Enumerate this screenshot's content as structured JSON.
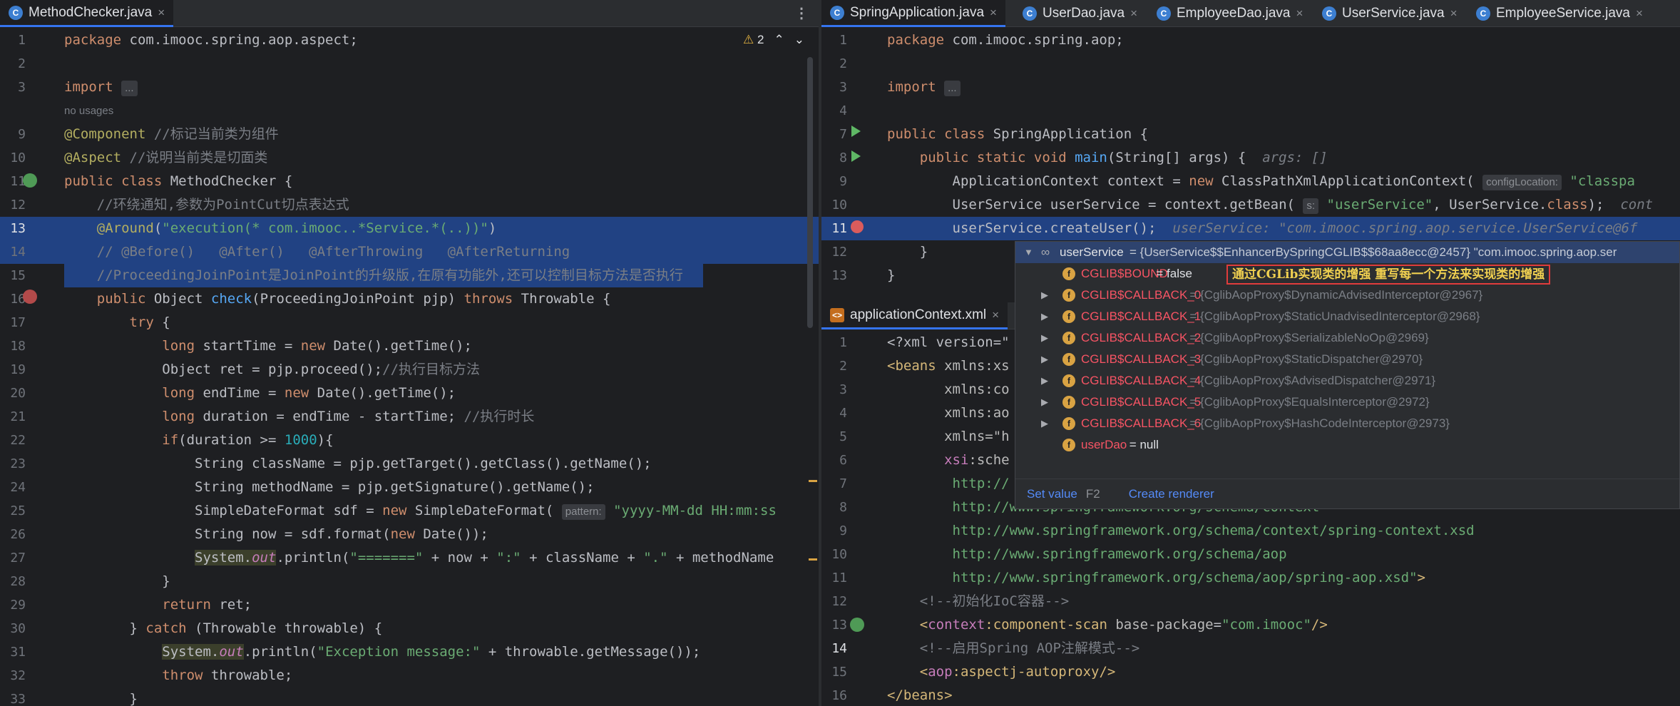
{
  "left_tabs": [
    {
      "label": "MethodChecker.java",
      "close": "×"
    }
  ],
  "right_top_tabs": [
    {
      "label": "SpringApplication.java",
      "close": "×"
    },
    {
      "label": "UserDao.java",
      "close": "×"
    },
    {
      "label": "EmployeeDao.java",
      "close": "×"
    },
    {
      "label": "UserService.java",
      "close": "×"
    },
    {
      "label": "EmployeeService.java",
      "close": "×"
    }
  ],
  "right_bottom_tab": {
    "label": "applicationContext.xml",
    "close": "×"
  },
  "kebab": "⋮",
  "warnings": {
    "count": "2",
    "up": "⌃",
    "down": "⌄",
    "triangle": "⚠"
  },
  "left_lines": [
    {
      "n": "1",
      "parts": [
        [
          "kw",
          "package "
        ],
        [
          "",
          "com.imooc.spring.aop.aspect;"
        ]
      ]
    },
    {
      "n": "2",
      "parts": []
    },
    {
      "n": "3",
      "parts": [
        [
          "kw",
          "import "
        ],
        [
          "hint",
          "..."
        ]
      ]
    },
    {
      "n": "",
      "parts": [
        [
          "usage",
          "no usages"
        ]
      ]
    },
    {
      "n": "9",
      "parts": [
        [
          "ann",
          "@Component "
        ],
        [
          "cmt",
          "//标记当前类为组件"
        ]
      ]
    },
    {
      "n": "10",
      "parts": [
        [
          "ann",
          "@Aspect "
        ],
        [
          "cmt",
          "//说明当前类是切面类"
        ]
      ]
    },
    {
      "n": "11",
      "parts": [
        [
          "kw",
          "public class "
        ],
        [
          "",
          "MethodChecker {"
        ]
      ]
    },
    {
      "n": "12",
      "parts": [
        [
          "",
          "    "
        ],
        [
          "cmt",
          "//环绕通知,参数为PointCut切点表达式"
        ]
      ]
    },
    {
      "n": "13",
      "parts": [
        [
          "",
          "    "
        ],
        [
          "ann",
          "@Around"
        ],
        [
          "",
          "("
        ],
        [
          "str",
          "\"execution(* com.imooc..*Service.*(..))\""
        ],
        [
          "",
          ")"
        ]
      ]
    },
    {
      "n": "14",
      "parts": [
        [
          "",
          "    "
        ],
        [
          "cmt",
          "// @Before()   @After()   @AfterThrowing   @AfterReturning"
        ]
      ]
    },
    {
      "n": "15",
      "parts": [
        [
          "",
          "    "
        ],
        [
          "cmt",
          "//ProceedingJoinPoint是JoinPoint的升级版,在原有功能外,还可以控制目标方法是否执行"
        ]
      ]
    },
    {
      "n": "16",
      "parts": [
        [
          "",
          "    "
        ],
        [
          "kw",
          "public "
        ],
        [
          "",
          "Object "
        ],
        [
          "fn",
          "check"
        ],
        [
          "",
          "(ProceedingJoinPoint pjp) "
        ],
        [
          "kw",
          "throws "
        ],
        [
          "",
          "Throwable {"
        ]
      ]
    },
    {
      "n": "17",
      "parts": [
        [
          "",
          "        "
        ],
        [
          "kw",
          "try "
        ],
        [
          "",
          "{"
        ]
      ]
    },
    {
      "n": "18",
      "parts": [
        [
          "",
          "            "
        ],
        [
          "kw",
          "long "
        ],
        [
          "",
          "startTime = "
        ],
        [
          "kw",
          "new "
        ],
        [
          "",
          "Date().getTime();"
        ]
      ]
    },
    {
      "n": "19",
      "parts": [
        [
          "",
          "            Object ret = pjp.proceed();"
        ],
        [
          "cmt",
          "//执行目标方法"
        ]
      ]
    },
    {
      "n": "20",
      "parts": [
        [
          "",
          "            "
        ],
        [
          "kw",
          "long "
        ],
        [
          "",
          "endTime = "
        ],
        [
          "kw",
          "new "
        ],
        [
          "",
          "Date().getTime();"
        ]
      ]
    },
    {
      "n": "21",
      "parts": [
        [
          "",
          "            "
        ],
        [
          "kw",
          "long "
        ],
        [
          "",
          "duration = endTime - startTime; "
        ],
        [
          "cmt",
          "//执行时长"
        ]
      ]
    },
    {
      "n": "22",
      "parts": [
        [
          "",
          "            "
        ],
        [
          "kw",
          "if"
        ],
        [
          "",
          "(duration >= "
        ],
        [
          "num",
          "1000"
        ],
        [
          "",
          "){"
        ]
      ]
    },
    {
      "n": "23",
      "parts": [
        [
          "",
          "                String className = pjp.getTarget().getClass().getName();"
        ]
      ]
    },
    {
      "n": "24",
      "parts": [
        [
          "",
          "                String methodName = pjp.getSignature().getName();"
        ]
      ]
    },
    {
      "n": "25",
      "parts": [
        [
          "",
          "                SimpleDateFormat sdf = "
        ],
        [
          "kw",
          "new "
        ],
        [
          "",
          "SimpleDateFormat( "
        ],
        [
          "hint",
          "pattern:"
        ],
        [
          "str",
          " \"yyyy-MM-dd HH:mm:ss"
        ]
      ]
    },
    {
      "n": "26",
      "parts": [
        [
          "",
          "                String now = sdf.format("
        ],
        [
          "kw",
          "new "
        ],
        [
          "",
          "Date());"
        ]
      ]
    },
    {
      "n": "27",
      "parts": [
        [
          "",
          "                "
        ],
        [
          "sys",
          "System."
        ],
        [
          "sysf",
          "out"
        ],
        [
          "",
          ".println("
        ],
        [
          "str",
          "\"=======\""
        ],
        [
          "",
          " + now + "
        ],
        [
          "str",
          "\":\""
        ],
        [
          "",
          " + className + "
        ],
        [
          "str",
          "\".\""
        ],
        [
          "",
          " + methodName"
        ]
      ]
    },
    {
      "n": "28",
      "parts": [
        [
          "",
          "            }"
        ]
      ]
    },
    {
      "n": "29",
      "parts": [
        [
          "",
          "            "
        ],
        [
          "kw",
          "return "
        ],
        [
          "",
          "ret;"
        ]
      ]
    },
    {
      "n": "30",
      "parts": [
        [
          "",
          "        } "
        ],
        [
          "kw",
          "catch "
        ],
        [
          "",
          "(Throwable throwable) {"
        ]
      ]
    },
    {
      "n": "31",
      "parts": [
        [
          "",
          "            "
        ],
        [
          "sys",
          "System."
        ],
        [
          "sysf",
          "out"
        ],
        [
          "",
          ".println("
        ],
        [
          "str",
          "\"Exception message:\""
        ],
        [
          "",
          " + throwable.getMessage());"
        ]
      ]
    },
    {
      "n": "32",
      "parts": [
        [
          "",
          "            "
        ],
        [
          "kw",
          "throw "
        ],
        [
          "",
          "throwable;"
        ]
      ]
    },
    {
      "n": "33",
      "parts": [
        [
          "",
          "        }"
        ]
      ]
    }
  ],
  "right_top_lines": [
    {
      "n": "1",
      "parts": [
        [
          "kw",
          "package "
        ],
        [
          "",
          "com.imooc.spring.aop;"
        ]
      ]
    },
    {
      "n": "2",
      "parts": []
    },
    {
      "n": "3",
      "parts": [
        [
          "kw",
          "import "
        ],
        [
          "hint",
          "..."
        ]
      ]
    },
    {
      "n": "4",
      "parts": []
    },
    {
      "n": "7",
      "parts": [
        [
          "kw",
          "public class "
        ],
        [
          "",
          "SpringApplication {"
        ]
      ]
    },
    {
      "n": "8",
      "parts": [
        [
          "",
          "    "
        ],
        [
          "kw",
          "public static void "
        ],
        [
          "fn",
          "main"
        ],
        [
          "",
          "(String[] args) {  "
        ],
        [
          "inl",
          "args: []"
        ]
      ]
    },
    {
      "n": "9",
      "parts": [
        [
          "",
          "        ApplicationContext context = "
        ],
        [
          "kw",
          "new "
        ],
        [
          "",
          "ClassPathXmlApplicationContext( "
        ],
        [
          "hint",
          "configLocation:"
        ],
        [
          "str",
          " \"classpa"
        ]
      ]
    },
    {
      "n": "10",
      "parts": [
        [
          "",
          "        UserService userService = context.getBean( "
        ],
        [
          "hint",
          "s:"
        ],
        [
          "str",
          " \"userService\""
        ],
        [
          "",
          ", UserService."
        ],
        [
          "kw",
          "class"
        ],
        [
          "",
          ");  "
        ],
        [
          "inl",
          "cont"
        ]
      ]
    },
    {
      "n": "11",
      "parts": [
        [
          "",
          "        userService.createUser();  "
        ],
        [
          "inl",
          "userService: \"com.imooc.spring.aop.service.UserService@6f"
        ]
      ]
    },
    {
      "n": "12",
      "parts": [
        [
          "",
          "    }"
        ]
      ]
    },
    {
      "n": "13",
      "parts": [
        [
          "",
          "}"
        ]
      ]
    }
  ],
  "right_bottom_lines": [
    {
      "n": "1",
      "parts": [
        [
          "",
          "<?xml version=\""
        ]
      ]
    },
    {
      "n": "2",
      "parts": [
        [
          "tag",
          "<beans "
        ],
        [
          "attr",
          "xmlns:xs"
        ]
      ]
    },
    {
      "n": "3",
      "parts": [
        [
          "",
          "       "
        ],
        [
          "attr",
          "xmlns:co"
        ]
      ]
    },
    {
      "n": "4",
      "parts": [
        [
          "",
          "       "
        ],
        [
          "attr",
          "xmlns:ao"
        ]
      ]
    },
    {
      "n": "5",
      "parts": [
        [
          "",
          "       "
        ],
        [
          "attr",
          "xmlns=\"h"
        ]
      ]
    },
    {
      "n": "6",
      "parts": [
        [
          "",
          "       "
        ],
        [
          "xns",
          "xsi"
        ],
        [
          "attr",
          ":sche"
        ]
      ]
    },
    {
      "n": "7",
      "parts": [
        [
          "",
          "        "
        ],
        [
          "str",
          "http://"
        ]
      ]
    },
    {
      "n": "8",
      "parts": [
        [
          "",
          "        "
        ],
        [
          "str",
          "http://www.springframework.org/schema/context"
        ]
      ]
    },
    {
      "n": "9",
      "parts": [
        [
          "",
          "        "
        ],
        [
          "str",
          "http://www.springframework.org/schema/context/spring-context.xsd"
        ]
      ]
    },
    {
      "n": "10",
      "parts": [
        [
          "",
          "        "
        ],
        [
          "str",
          "http://www.springframework.org/schema/aop"
        ]
      ]
    },
    {
      "n": "11",
      "parts": [
        [
          "",
          "        "
        ],
        [
          "str",
          "http://www.springframework.org/schema/aop/spring-aop.xsd\""
        ],
        [
          "tag",
          ">"
        ]
      ]
    },
    {
      "n": "12",
      "parts": [
        [
          "",
          "    "
        ],
        [
          "cmt",
          "<!--初始化IoC容器-->"
        ]
      ]
    },
    {
      "n": "13",
      "parts": [
        [
          "",
          "    "
        ],
        [
          "tag",
          "<"
        ],
        [
          "xns",
          "context"
        ],
        [
          "tag",
          ":component-scan "
        ],
        [
          "attr",
          "base-package"
        ],
        [
          "",
          "="
        ],
        [
          "str",
          "\"com.imooc\""
        ],
        [
          "tag",
          "/>"
        ]
      ]
    },
    {
      "n": "14",
      "parts": [
        [
          "",
          "    "
        ],
        [
          "cmt",
          "<!--启用Spring AOP注解模式-->"
        ]
      ]
    },
    {
      "n": "15",
      "parts": [
        [
          "",
          "    "
        ],
        [
          "tag",
          "<"
        ],
        [
          "xns",
          "aop"
        ],
        [
          "tag",
          ":aspectj-autoproxy/>"
        ]
      ]
    },
    {
      "n": "16",
      "parts": [
        [
          "tag",
          "</beans>"
        ]
      ]
    }
  ],
  "debug_popup": {
    "root": {
      "name": "userService",
      "value": " = {UserService$$EnhancerBySpringCGLIB$$68aa8ecc@2457} \"com.imooc.spring.aop.ser"
    },
    "annotation": "通过CGLib实现类的增强 重写每一个方法来实现类的增强",
    "fields": [
      {
        "name": "CGLIB$BOUND",
        "value": " = false",
        "expandable": false
      },
      {
        "name": "CGLIB$CALLBACK_0",
        "value": " = {CglibAopProxy$DynamicAdvisedInterceptor@2967}",
        "expandable": true
      },
      {
        "name": "CGLIB$CALLBACK_1",
        "value": " = {CglibAopProxy$StaticUnadvisedInterceptor@2968}",
        "expandable": true
      },
      {
        "name": "CGLIB$CALLBACK_2",
        "value": " = {CglibAopProxy$SerializableNoOp@2969}",
        "expandable": true
      },
      {
        "name": "CGLIB$CALLBACK_3",
        "value": " = {CglibAopProxy$StaticDispatcher@2970}",
        "expandable": true
      },
      {
        "name": "CGLIB$CALLBACK_4",
        "value": " = {CglibAopProxy$AdvisedDispatcher@2971}",
        "expandable": true
      },
      {
        "name": "CGLIB$CALLBACK_5",
        "value": " = {CglibAopProxy$EqualsInterceptor@2972}",
        "expandable": true
      },
      {
        "name": "CGLIB$CALLBACK_6",
        "value": " = {CglibAopProxy$HashCodeInterceptor@2973}",
        "expandable": true
      },
      {
        "name": "userDao",
        "value": " = null",
        "expandable": false
      }
    ],
    "set_value": "Set value",
    "set_value_key": "F2",
    "create_renderer": "Create renderer"
  }
}
